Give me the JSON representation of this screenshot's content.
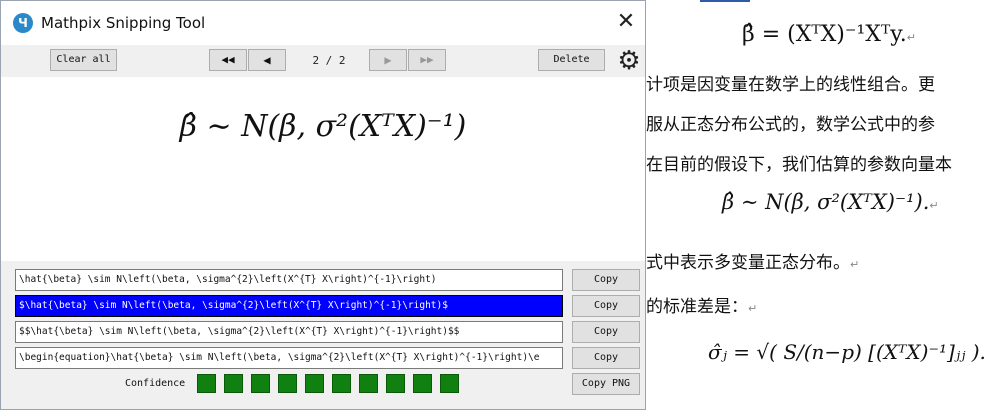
{
  "window": {
    "title": "Mathpix Snipping Tool",
    "close_glyph": "✕",
    "app_icon_glyph": "Ч"
  },
  "toolbar": {
    "clear_all": "Clear all",
    "first_glyph": "◀◀",
    "prev_glyph": "◀",
    "page_indicator": "2 / 2",
    "next_glyph": "▶",
    "last_glyph": "▶▶",
    "delete": "Delete",
    "settings_glyph": "⚙"
  },
  "preview": {
    "equation_display": "β̂ ∼ N(β, σ²(XᵀX)⁻¹)"
  },
  "results": [
    {
      "latex": "\\hat{\\beta} \\sim N\\left(\\beta, \\sigma^{2}\\left(X^{T} X\\right)^{-1}\\right)",
      "copy": "Copy",
      "selected": false
    },
    {
      "latex": "$\\hat{\\beta} \\sim N\\left(\\beta, \\sigma^{2}\\left(X^{T} X\\right)^{-1}\\right)$",
      "copy": "Copy",
      "selected": true
    },
    {
      "latex": "$$\\hat{\\beta} \\sim N\\left(\\beta, \\sigma^{2}\\left(X^{T} X\\right)^{-1}\\right)$$",
      "copy": "Copy",
      "selected": false
    },
    {
      "latex": "\\begin{equation}\\hat{\\beta} \\sim N\\left(\\beta, \\sigma^{2}\\left(X^{T} X\\right)^{-1}\\right)\\e",
      "copy": "Copy",
      "selected": false
    }
  ],
  "confidence": {
    "label": "Confidence",
    "level": "10/10",
    "color": "#108010"
  },
  "copy_png": "Copy PNG",
  "document": {
    "eq1": "β̂ = (XᵀX)⁻¹Xᵀy.",
    "line1": "计项是因变量在数学上的线性组合。更",
    "line2": "服从正态分布公式的，数学公式中的参",
    "line3": "在目前的假设下，我们估算的参数向量本",
    "eq2": "β̂ ∼ N(β, σ²(XᵀX)⁻¹).",
    "line4": "式中表示多变量正态分布。",
    "line5": "的标准差是：",
    "eq3": "σ̂ⱼ = √( S/(n−p) [(XᵀX)⁻¹]ⱼⱼ ).",
    "paragraph_mark": "↵"
  }
}
